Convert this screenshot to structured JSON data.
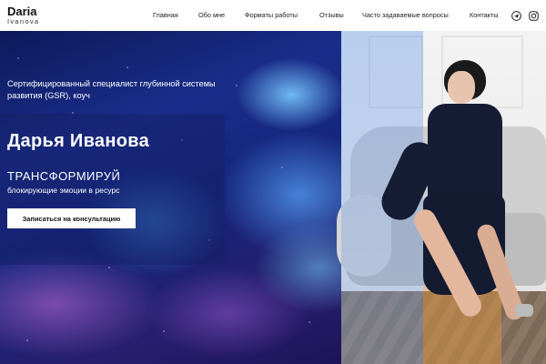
{
  "logo": {
    "main": "Daria",
    "sub": "Ivanova"
  },
  "nav": {
    "items": [
      "Главная",
      "Обо мне",
      "Форматы работы",
      "Отзывы",
      "Часто задаваемые вопросы",
      "Контакты"
    ]
  },
  "social": {
    "icons": [
      "telegram-icon",
      "instagram-icon"
    ]
  },
  "hero": {
    "subtitle": "Сертифицированный специалист глубинной системы развития (GSR), коуч",
    "name": "Дарья Иванова",
    "tagline": "ТРАНСФОРМИРУЙ",
    "tagline_sub": "блокирующие эмоции в ресурс",
    "cta_label": "Записаться на консультацию"
  }
}
